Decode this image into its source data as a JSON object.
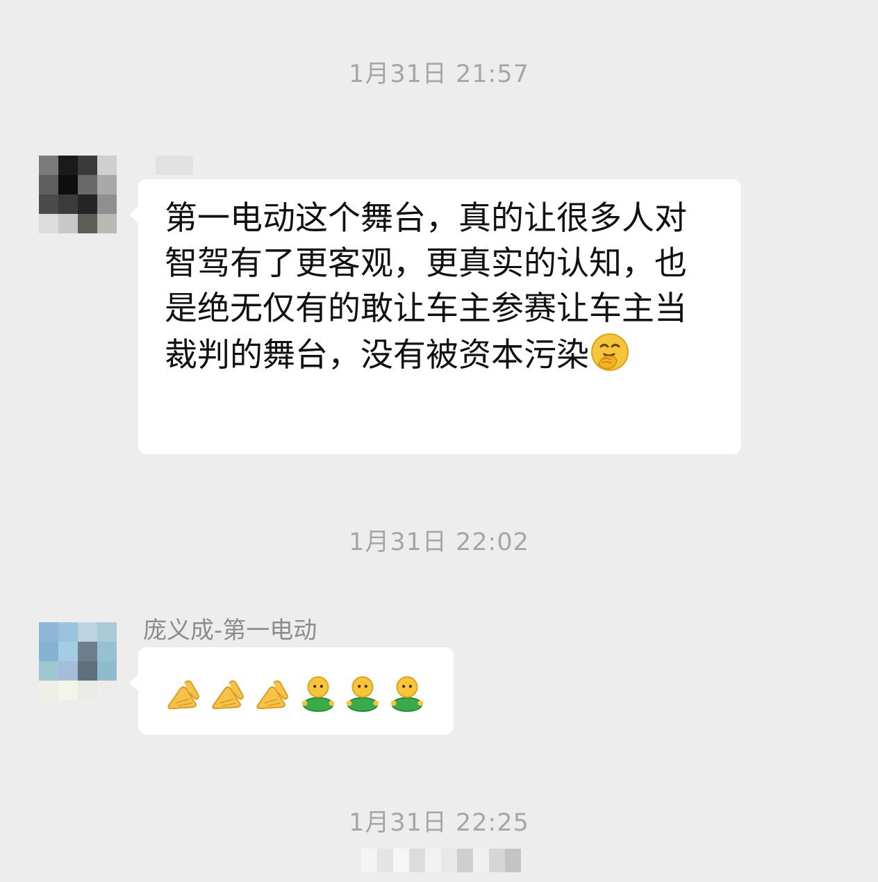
{
  "timestamps": [
    "1月31日 21:57",
    "1月31日 22:02",
    "1月31日 22:25"
  ],
  "messages": [
    {
      "sender": "",
      "text": "第一电动这个舞台，真的让很多人对智驾有了更客观，更真实的认知，也是绝无仅有的敢让车主参赛让车主当裁判的舞台，没有被资本污染",
      "trailing_emoji": "face-with-hand-over-mouth"
    },
    {
      "sender": "庞义成-第一电动",
      "emojis": [
        "pinched-hand",
        "pinched-hand",
        "pinched-hand",
        "green-person",
        "green-person",
        "green-person"
      ]
    }
  ],
  "colors": {
    "background": "#ededed",
    "bubble": "#ffffff",
    "timestamp": "#a6a6a6",
    "sender_name": "#8c8c8c"
  }
}
